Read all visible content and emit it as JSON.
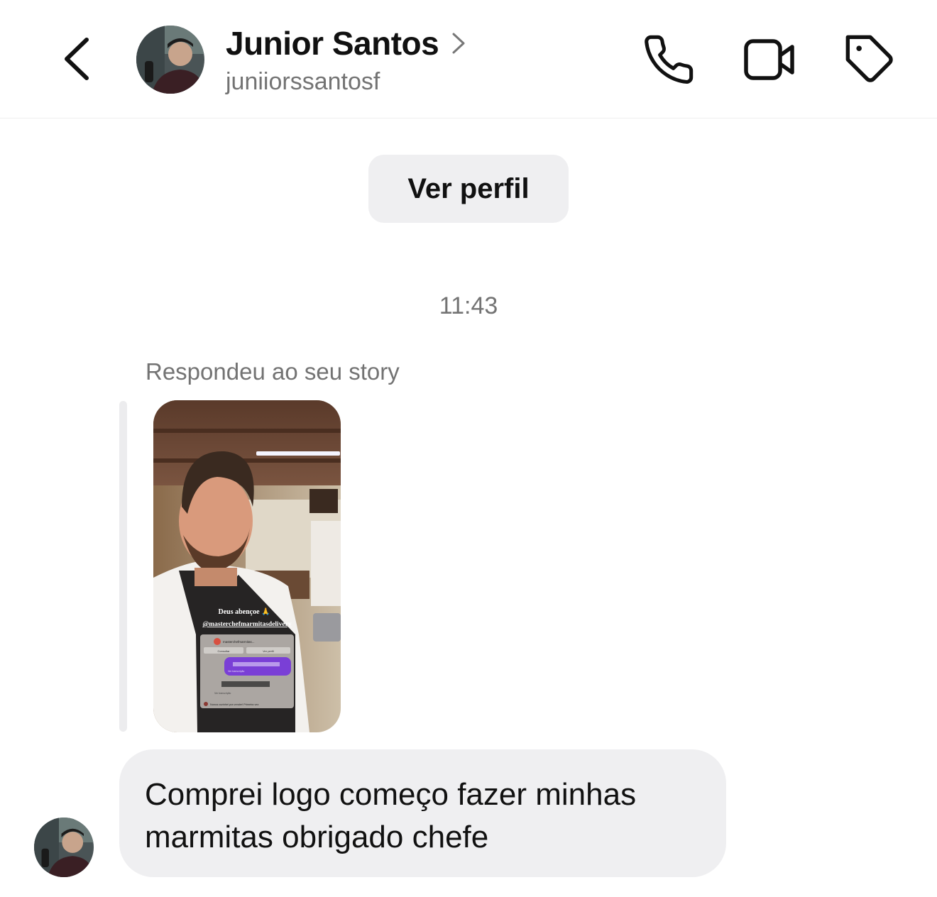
{
  "header": {
    "contact_name": "Junior Santos",
    "username": "juniiorssantosf",
    "icons": [
      "back-chevron-icon",
      "phone-icon",
      "video-camera-icon",
      "tag-icon"
    ]
  },
  "view_profile_label": "Ver perfil",
  "timestamp": "11:43",
  "story_reply": {
    "label": "Respondeu ao seu story",
    "overlay_caption": "Deus abençoe 🙏",
    "overlay_mention": "@masterchefmarmitasdelivery",
    "mini_chat": {
      "title": "masterchefmarmitas...",
      "btn_left": "Consultar",
      "btn_right": "Ver perfil",
      "transcript_label": "Ver transcrição",
      "last_message": "Nunca cozinhei pra vender! Primeira vez"
    }
  },
  "message": {
    "text": "Comprei logo começo fazer minhas marmitas obrigado chefe"
  },
  "colors": {
    "bubble_bg": "#efeff1",
    "secondary_text": "#737373",
    "primary_text": "#111111",
    "voice_purple": "#7a3fd6"
  }
}
